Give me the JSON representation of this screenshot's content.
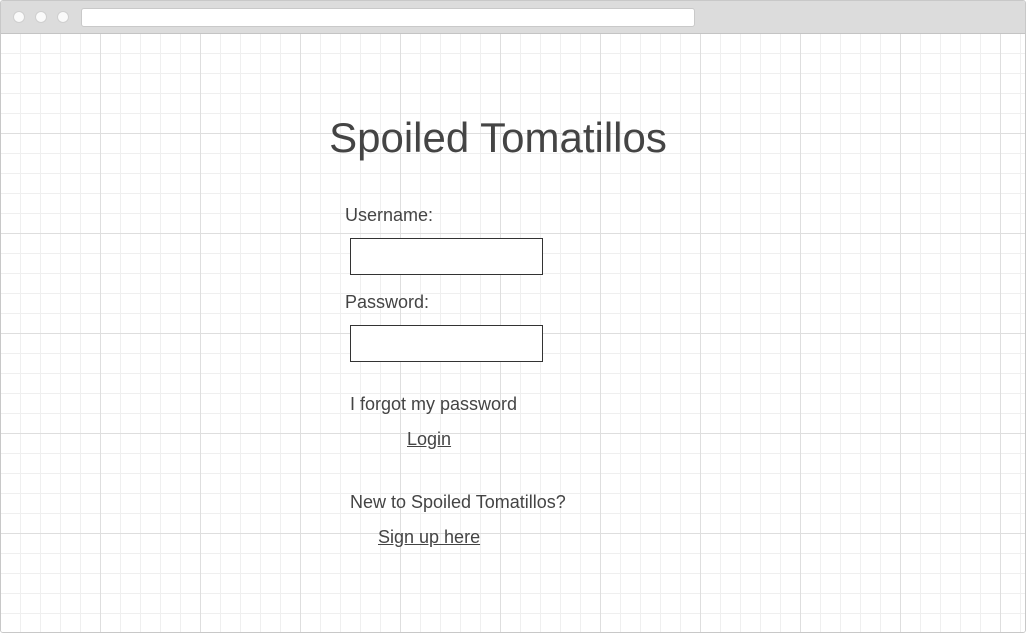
{
  "browser": {
    "address_bar_value": ""
  },
  "page": {
    "title": "Spoiled Tomatillos",
    "username_label": "Username:",
    "username_value": "",
    "password_label": "Password:",
    "password_value": "",
    "forgot_password_link": "I forgot my password",
    "login_button": "Login",
    "new_user_text": "New to Spoiled Tomatillos?",
    "signup_link": "Sign up here"
  }
}
